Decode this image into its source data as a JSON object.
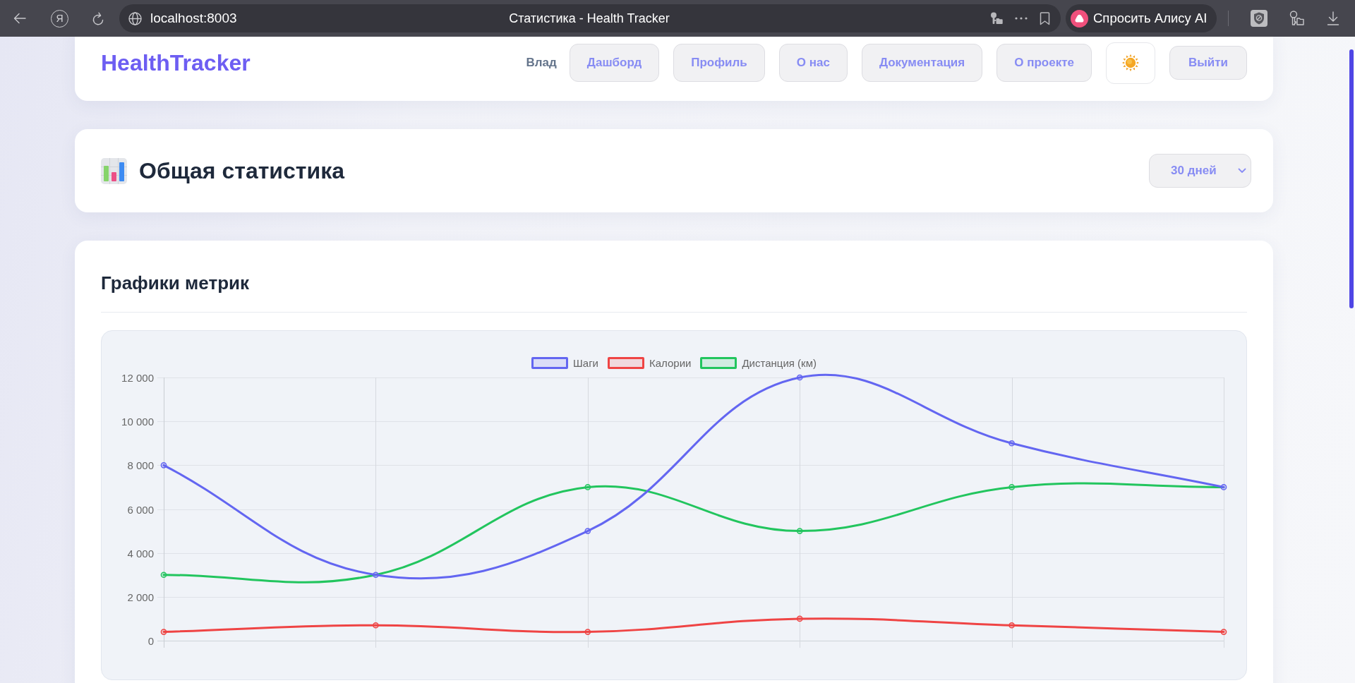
{
  "browser": {
    "logo_letter": "Я",
    "address": "localhost:8003",
    "tab_title": "Статистика - Health Tracker",
    "assistant_button": "Спросить Алису AI"
  },
  "header": {
    "logo": "HealthTracker",
    "user_name": "Влад",
    "nav": [
      {
        "label": "Дашборд"
      },
      {
        "label": "Профиль"
      },
      {
        "label": "О нас"
      },
      {
        "label": "Документация"
      },
      {
        "label": "О проекте"
      }
    ],
    "logout": "Выйти"
  },
  "stats_header": {
    "title": "Общая статистика",
    "period_select": {
      "value": "30 дней"
    }
  },
  "metrics": {
    "title": "Графики метрик",
    "chart_data": {
      "type": "line",
      "grid": true,
      "legend": true,
      "ylim": [
        0,
        12000
      ],
      "yticks": [
        {
          "value": 0,
          "label": "0"
        },
        {
          "value": 2000,
          "label": "2 000"
        },
        {
          "value": 4000,
          "label": "4 000"
        },
        {
          "value": 6000,
          "label": "6 000"
        },
        {
          "value": 8000,
          "label": "8 000"
        },
        {
          "value": 10000,
          "label": "10 000"
        },
        {
          "value": 12000,
          "label": "12 000"
        }
      ],
      "series": [
        {
          "name": "Шаги",
          "color": "#6366f1",
          "marker": "circle",
          "values": [
            8000,
            3000,
            5000,
            12000,
            9000,
            7000
          ]
        },
        {
          "name": "Калории",
          "color": "#ef4444",
          "marker": "circle",
          "values": [
            400,
            700,
            400,
            1000,
            700,
            400
          ]
        },
        {
          "name": "Дистанция (км)",
          "color": "#22c55e",
          "marker": "circle",
          "values": [
            3000,
            3000,
            7000,
            5000,
            7000,
            7000
          ]
        }
      ]
    }
  }
}
